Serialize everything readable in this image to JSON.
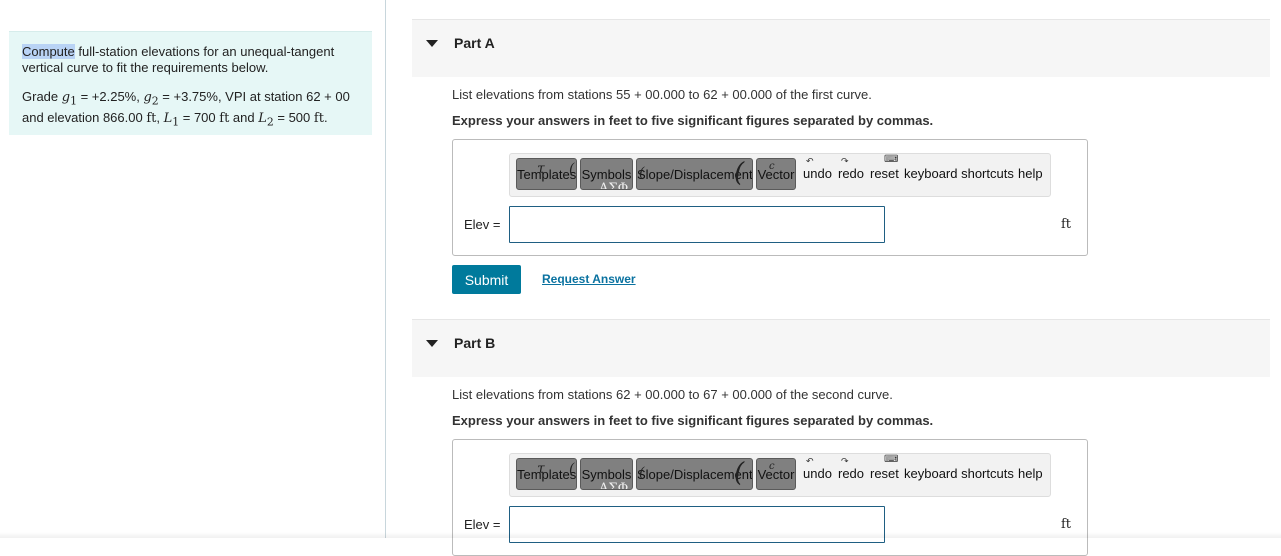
{
  "problem": {
    "highlight_word": "Compute",
    "line1_rest": " full-station elevations for an unequal-tangent vertical curve to fit the requirements below.",
    "grade_label": "Grade ",
    "g1": "g",
    "g1_sub": "1",
    "g1_val": " = +2.25%, ",
    "g2": "g",
    "g2_sub": "2",
    "g2_val": " = +3.75%, VPI at station 62 + 00 and elevation 866.00 ",
    "ft": "ft",
    "sep1": ", ",
    "L1": "L",
    "L1_sub": "1",
    "L1_val": " = 700 ",
    "and": " and ",
    "L2": "L",
    "L2_sub": "2",
    "L2_val": " = 500 ",
    "end": "."
  },
  "toolbar": {
    "templates": "Templates",
    "symbols": "Symbols",
    "slope": "Slope/Displacement",
    "vector": "Vector",
    "undo": "undo",
    "redo": "redo",
    "reset": "reset",
    "keyboard_shortcuts": "keyboard shortcuts",
    "help": "help"
  },
  "parts": [
    {
      "title": "Part A",
      "prompt": "List elevations from stations 55 + 00.000 to 62 + 00.000 of the first curve.",
      "instruction": "Express your answers in feet to five significant figures separated by commas.",
      "input_label": "Elev =",
      "input_value": "",
      "unit": "ft"
    },
    {
      "title": "Part B",
      "prompt": "List elevations from stations 62 + 00.000 to 67 + 00.000 of the second curve.",
      "instruction": "Express your answers in feet to five significant figures separated by commas.",
      "input_label": "Elev =",
      "input_value": "",
      "unit": "ft"
    }
  ],
  "actions": {
    "submit": "Submit",
    "request_answer": "Request Answer"
  }
}
